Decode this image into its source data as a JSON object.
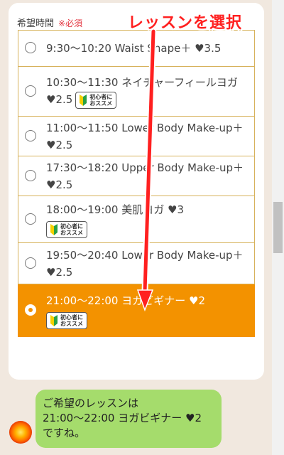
{
  "form": {
    "label": "希望時間",
    "required": "※必須",
    "badge_line1": "初心者に",
    "badge_line2": "おススメ"
  },
  "annotation": {
    "text": "レッスンを選択"
  },
  "options": [
    {
      "text": "9:30〜10:20 Waist Shape＋ ♥3.5",
      "selected": false,
      "badge": false
    },
    {
      "text": "10:30〜11:30 ネイチャーフィールヨガ ♥2.5",
      "selected": false,
      "badge": true
    },
    {
      "text": "11:00〜11:50 Lower Body Make-up＋ ♥2.5",
      "selected": false,
      "badge": false
    },
    {
      "text": "17:30〜18:20 Upper Body Make-up＋ ♥2.5",
      "selected": false,
      "badge": false
    },
    {
      "text": "18:00〜19:00 美肌ヨガ ♥3",
      "selected": false,
      "badge": true
    },
    {
      "text": "19:50〜20:40 Lower Body Make-up＋ ♥2.5",
      "selected": false,
      "badge": false
    },
    {
      "text": "21:00〜22:00 ヨガビギナー ♥2",
      "selected": true,
      "badge": true
    }
  ],
  "chat": {
    "line1": "ご希望のレッスンは",
    "line2": "21:00〜22:00 ヨガビギナー ♥2",
    "line3": "ですね。"
  },
  "icons": {
    "badge": "beginner-mark-icon",
    "avatar": "sun-avatar-icon"
  },
  "colors": {
    "accent": "#f39200",
    "border": "#d7b25b",
    "required": "#e3343f",
    "annotation": "#ff2020",
    "chat_bubble": "#a5dc6c",
    "background": "#f1e8df"
  }
}
